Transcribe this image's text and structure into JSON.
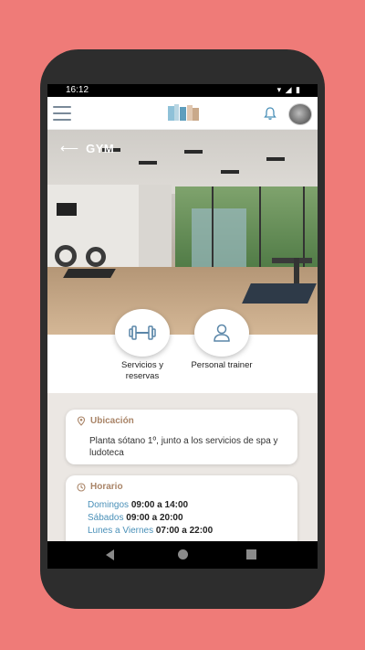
{
  "status_bar": {
    "time": "16:12",
    "icons": [
      "wifi-icon",
      "signal-icon",
      "battery-icon"
    ]
  },
  "app_bar": {
    "menu_icon": "hamburger-menu-icon",
    "notifications_icon": "bell-icon",
    "avatar": "user-avatar"
  },
  "hero": {
    "title": "GYM",
    "back_icon": "arrow-left-icon"
  },
  "actions": [
    {
      "label": "Servicios y\nreservas",
      "icon": "dumbbell-icon"
    },
    {
      "label": "Personal trainer",
      "icon": "person-icon"
    }
  ],
  "location_card": {
    "heading": "Ubicación",
    "icon": "location-pin-icon",
    "text": "Planta sótano 1º, junto a los servicios de spa y ludoteca"
  },
  "schedule_card": {
    "heading": "Horario",
    "icon": "clock-icon",
    "rows": [
      {
        "day": "Domingos",
        "time": "09:00 a 14:00"
      },
      {
        "day": "Sábados",
        "time": "09:00 a 20:00"
      },
      {
        "day": "Lunes a Viernes",
        "time": "07:00 a 22:00"
      }
    ]
  },
  "colors": {
    "background": "#ef7b78",
    "accent_brown": "#a98467",
    "accent_blue": "#4a90b8",
    "icon_blue": "#5a86a8"
  }
}
